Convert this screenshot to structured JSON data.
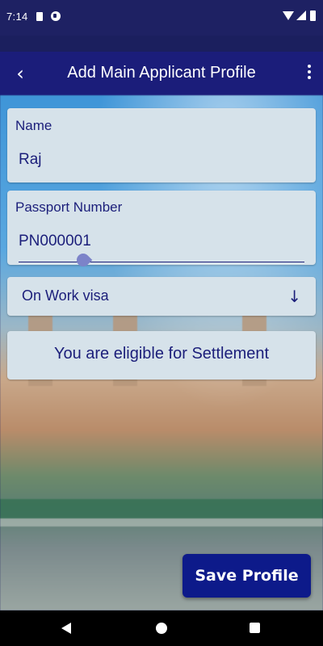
{
  "status_bar": {
    "time": "7:14",
    "icons": [
      "sd-card-icon",
      "notification-icon",
      "wifi-icon",
      "signal-icon",
      "battery-icon"
    ]
  },
  "app_bar": {
    "title": "Add Main Applicant Profile",
    "back_icon": "back-arrow-icon",
    "menu_icon": "more-vert-icon"
  },
  "form": {
    "name": {
      "label": "Name",
      "value": "Raj"
    },
    "passport": {
      "label": "Passport Number",
      "value": "PN000001"
    },
    "visa_type": {
      "selected": "On Work visa",
      "icon": "arrow-down-icon"
    },
    "eligibility_message": "You are eligible for Settlement"
  },
  "actions": {
    "save_label": "Save Profile"
  },
  "colors": {
    "primary": "#1b1d7a",
    "button": "#0d1a8a",
    "card": "#d6e2ea",
    "text": "#1b1e7a"
  },
  "nav_bar": {
    "icons": [
      "nav-back-icon",
      "nav-home-icon",
      "nav-recents-icon"
    ]
  }
}
